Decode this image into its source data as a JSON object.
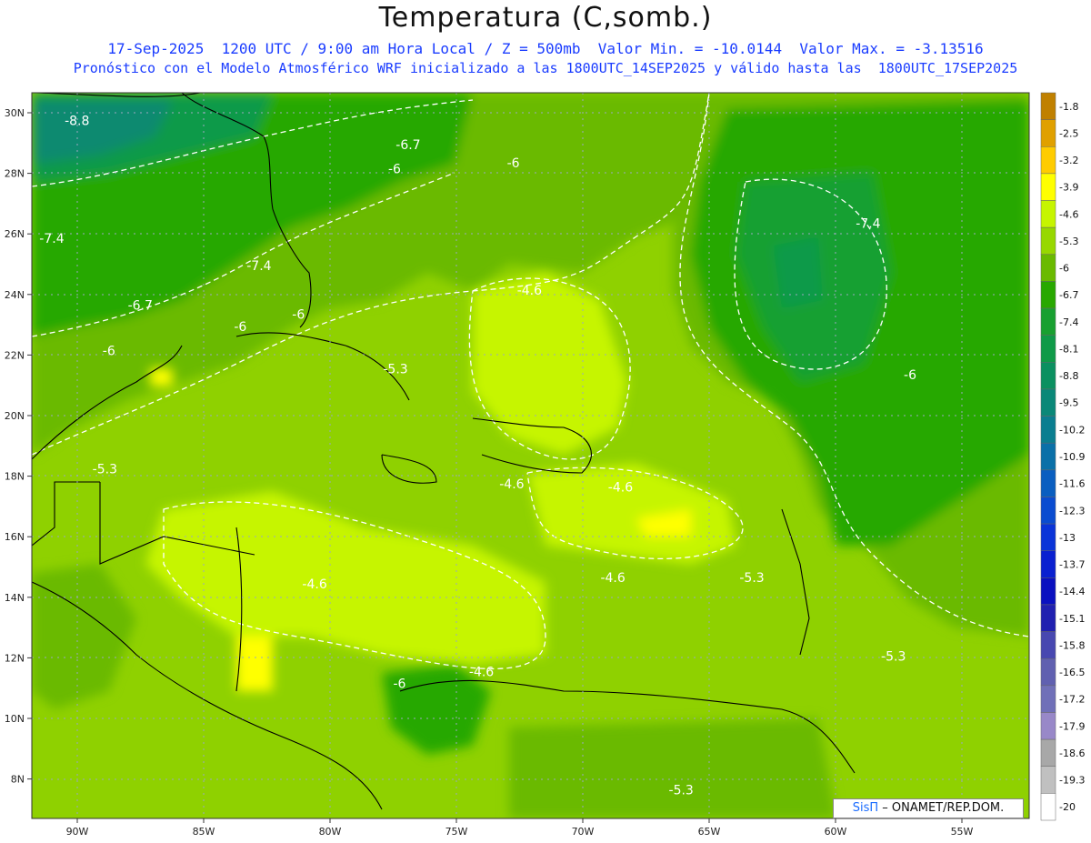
{
  "header": {
    "title": "Temperatura (C,somb.)",
    "subtitle_line1": "17-Sep-2025  1200 UTC / 9:00 am Hora Local / Z = 500mb  Valor Min. = -10.0144  Valor Max. = -3.13516",
    "subtitle_line2": "Pronóstico con el Modelo Atmosférico WRF inicializado a las 1800UTC_14SEP2025 y válido hasta las  1800UTC_17SEP2025"
  },
  "map": {
    "lat_labels": [
      "30N",
      "28N",
      "26N",
      "24N",
      "22N",
      "20N",
      "18N",
      "16N",
      "14N",
      "12N",
      "10N",
      "8N"
    ],
    "lon_labels": [
      "90W",
      "85W",
      "80W",
      "75W",
      "70W",
      "65W",
      "60W",
      "55W"
    ],
    "contour_labels": [
      {
        "text": "-8.8",
        "lon": -90.5,
        "lat": 29.6
      },
      {
        "text": "-6.7",
        "lon": -77.4,
        "lat": 28.8
      },
      {
        "text": "-6",
        "lon": -77.7,
        "lat": 28.0
      },
      {
        "text": "-6",
        "lon": -73.0,
        "lat": 28.2
      },
      {
        "text": "-7.4",
        "lon": -91.5,
        "lat": 25.7
      },
      {
        "text": "-7.4",
        "lon": -83.3,
        "lat": 24.8
      },
      {
        "text": "-6.7",
        "lon": -88.0,
        "lat": 23.5
      },
      {
        "text": "-6",
        "lon": -83.8,
        "lat": 22.8
      },
      {
        "text": "-6",
        "lon": -81.5,
        "lat": 23.2
      },
      {
        "text": "-6",
        "lon": -89.0,
        "lat": 22.0
      },
      {
        "text": "-4.6",
        "lon": -72.6,
        "lat": 24.0
      },
      {
        "text": "-7.4",
        "lon": -59.2,
        "lat": 26.2
      },
      {
        "text": "-5.3",
        "lon": -77.9,
        "lat": 21.4
      },
      {
        "text": "-6",
        "lon": -57.3,
        "lat": 21.2
      },
      {
        "text": "-5.3",
        "lon": -89.4,
        "lat": 18.1
      },
      {
        "text": "-4.6",
        "lon": -73.3,
        "lat": 17.6
      },
      {
        "text": "-4.6",
        "lon": -69.0,
        "lat": 17.5
      },
      {
        "text": "-4.6",
        "lon": -69.3,
        "lat": 14.5
      },
      {
        "text": "-5.3",
        "lon": -63.8,
        "lat": 14.5
      },
      {
        "text": "-4.6",
        "lon": -81.1,
        "lat": 14.3
      },
      {
        "text": "-5.3",
        "lon": -58.2,
        "lat": 11.9
      },
      {
        "text": "-4.6",
        "lon": -74.5,
        "lat": 11.4
      },
      {
        "text": "-6",
        "lon": -77.5,
        "lat": 11.0
      },
      {
        "text": "-5.3",
        "lon": -66.6,
        "lat": 7.5
      }
    ]
  },
  "legend": {
    "levels": [
      "-1.8",
      "-2.5",
      "-3.2",
      "-3.9",
      "-4.6",
      "-5.3",
      "-6",
      "-6.7",
      "-7.4",
      "-8.1",
      "-8.8",
      "-9.5",
      "-10.2",
      "-10.9",
      "-11.6",
      "-12.3",
      "-13",
      "-13.7",
      "-14.4",
      "-15.1",
      "-15.8",
      "-16.5",
      "-17.2",
      "-17.9",
      "-18.6",
      "-19.3",
      "-20"
    ],
    "colors": [
      "#c08000",
      "#e0a000",
      "#ffcc00",
      "#ffff00",
      "#c6f500",
      "#97d800",
      "#6aba00",
      "#28a800",
      "#18a030",
      "#0f9a48",
      "#0b9060",
      "#0a8878",
      "#0a7e90",
      "#0a70a8",
      "#0a5ec0",
      "#0a4cd0",
      "#0a34d8",
      "#0a20d0",
      "#0a10c0",
      "#2020b0",
      "#4848b0",
      "#6060b0",
      "#7070b8",
      "#9888c8",
      "#a8a8a8",
      "#c0c0c0",
      "#ffffff"
    ]
  },
  "credit": {
    "brand": "SisΠ",
    "text": "– ONAMET/REP.DOM."
  }
}
